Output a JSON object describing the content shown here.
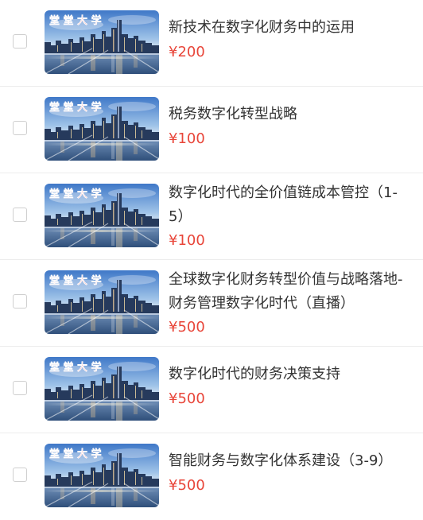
{
  "colors": {
    "price": "#e8463a",
    "title": "#333333",
    "divider": "#ececec",
    "checkbox_border": "#cfcfcf"
  },
  "thumbnail_text": "堂 堂 大 学",
  "courses": [
    {
      "title": "新技术在数字化财务中的运用",
      "price": "¥200"
    },
    {
      "title": "税务数字化转型战略",
      "price": "¥100"
    },
    {
      "title": "数字化时代的全价值链成本管控（1-5）",
      "price": "¥100"
    },
    {
      "title": "全球数字化财务转型价值与战略落地-财务管理数字化时代（直播）",
      "price": "¥500"
    },
    {
      "title": "数字化时代的财务决策支持",
      "price": "¥500"
    },
    {
      "title": "智能财务与数字化体系建设（3-9）",
      "price": "¥500"
    }
  ]
}
